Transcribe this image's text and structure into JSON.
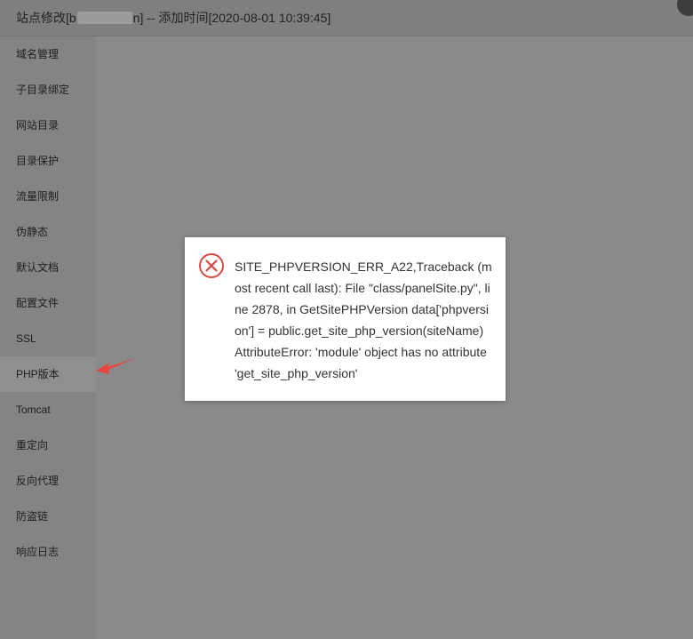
{
  "window": {
    "title_prefix": "站点修改[b",
    "title_suffix": "n] -- 添加时间[2020-08-01 10:39:45]"
  },
  "sidebar": {
    "items": [
      {
        "label": "域名管理"
      },
      {
        "label": "子目录绑定"
      },
      {
        "label": "网站目录"
      },
      {
        "label": "目录保护"
      },
      {
        "label": "流量限制"
      },
      {
        "label": "伪静态"
      },
      {
        "label": "默认文档"
      },
      {
        "label": "配置文件"
      },
      {
        "label": "SSL"
      },
      {
        "label": "PHP版本"
      },
      {
        "label": "Tomcat"
      },
      {
        "label": "重定向"
      },
      {
        "label": "反向代理"
      },
      {
        "label": "防盗链"
      },
      {
        "label": "响应日志"
      }
    ]
  },
  "dialog": {
    "icon": "error-circle-icon",
    "message": "SITE_PHPVERSION_ERR_A22,Traceback (most recent call last): File \"class/panelSite.py\", line 2878, in GetSitePHPVersion data['phpversion'] = public.get_site_php_version(siteName) AttributeError: 'module' object has no attribute 'get_site_php_version'"
  },
  "colors": {
    "overlay": "#8a8a8a",
    "error_red": "#e0473d",
    "arrow_red": "#f0413a"
  }
}
